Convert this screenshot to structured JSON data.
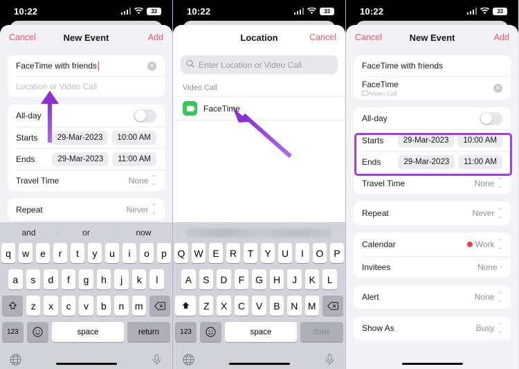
{
  "status_bar": {
    "time": "10:22",
    "battery": "33",
    "wifi_icon": "wifi-icon",
    "signal_icon": "cellular-signal-icon"
  },
  "panel1": {
    "nav": {
      "left": "Cancel",
      "title": "New Event",
      "right": "Add"
    },
    "title_field": {
      "value": "FaceTime with friends",
      "clear_icon": "clear-circle-icon"
    },
    "location_field": {
      "placeholder": "Location or Video Call"
    },
    "allday": {
      "label": "All-day",
      "state": "off"
    },
    "starts": {
      "label": "Starts",
      "date": "29-Mar-2023",
      "time": "10:00 AM"
    },
    "ends": {
      "label": "Ends",
      "date": "29-Mar-2023",
      "time": "11:00 AM"
    },
    "travel_time": {
      "label": "Travel Time",
      "value": "None"
    },
    "repeat": {
      "label": "Repeat",
      "value": "Never"
    },
    "keyboard": {
      "predictions": [
        "and",
        "or",
        "now"
      ],
      "row1": [
        "q",
        "w",
        "e",
        "r",
        "t",
        "y",
        "u",
        "i",
        "o",
        "p"
      ],
      "row2": [
        "a",
        "s",
        "d",
        "f",
        "g",
        "h",
        "j",
        "k",
        "l"
      ],
      "row3": [
        "z",
        "x",
        "c",
        "v",
        "b",
        "n",
        "m"
      ],
      "shift": "shift-icon",
      "backspace": "backspace-icon",
      "numbers": "123",
      "emoji": "emoji-icon",
      "space": "space",
      "action": "return",
      "globe": "globe-icon",
      "mic": "microphone-icon"
    },
    "annotation": {
      "arrow": "purple-up-arrow",
      "color": "#9b3fd4"
    }
  },
  "panel2": {
    "nav": {
      "title": "Location",
      "right": "Cancel"
    },
    "search": {
      "placeholder": "Enter Location or Video Call",
      "icon": "search-icon"
    },
    "section": {
      "header": "Video Call"
    },
    "facetime_row": {
      "label": "FaceTime",
      "icon": "facetime-icon",
      "icon_color": "#34c759"
    },
    "keyboard": {
      "row1": [
        "Q",
        "W",
        "E",
        "R",
        "T",
        "Y",
        "U",
        "I",
        "O",
        "P"
      ],
      "row2": [
        "A",
        "S",
        "D",
        "F",
        "G",
        "H",
        "J",
        "K",
        "L"
      ],
      "row3": [
        "Z",
        "X",
        "C",
        "V",
        "B",
        "N",
        "M"
      ],
      "shift": "shift-filled-icon",
      "backspace": "backspace-icon",
      "numbers": "123",
      "emoji": "emoji-icon",
      "space": "space",
      "action": "done",
      "globe": "globe-icon",
      "mic": "microphone-icon"
    },
    "annotation": {
      "arrow": "purple-diagonal-arrow",
      "color": "#9b3fd4"
    }
  },
  "panel3": {
    "nav": {
      "left": "Cancel",
      "title": "New Event",
      "right": "Add"
    },
    "title_field": {
      "value": "FaceTime with friends"
    },
    "location_row": {
      "value": "FaceTime",
      "subtitle": "Video Call",
      "sub_icon": "video-camera-icon",
      "clear_icon": "clear-circle-icon"
    },
    "allday": {
      "label": "All-day",
      "state": "off"
    },
    "starts": {
      "label": "Starts",
      "date": "29-Mar-2023",
      "time": "10:00 AM"
    },
    "ends": {
      "label": "Ends",
      "date": "29-Mar-2023",
      "time": "11:00 AM"
    },
    "travel_time": {
      "label": "Travel Time",
      "value": "None"
    },
    "repeat": {
      "label": "Repeat",
      "value": "Never"
    },
    "calendar": {
      "label": "Calendar",
      "value": "Work",
      "dot_color": "#ef3b4e"
    },
    "invitees": {
      "label": "Invitees",
      "value": "None"
    },
    "alert": {
      "label": "Alert",
      "value": "None"
    },
    "show_as": {
      "label": "Show As",
      "value": "Busy"
    },
    "annotation": {
      "highlight": "purple-rectangle-around-starts-ends",
      "color": "#a23ee0"
    }
  }
}
